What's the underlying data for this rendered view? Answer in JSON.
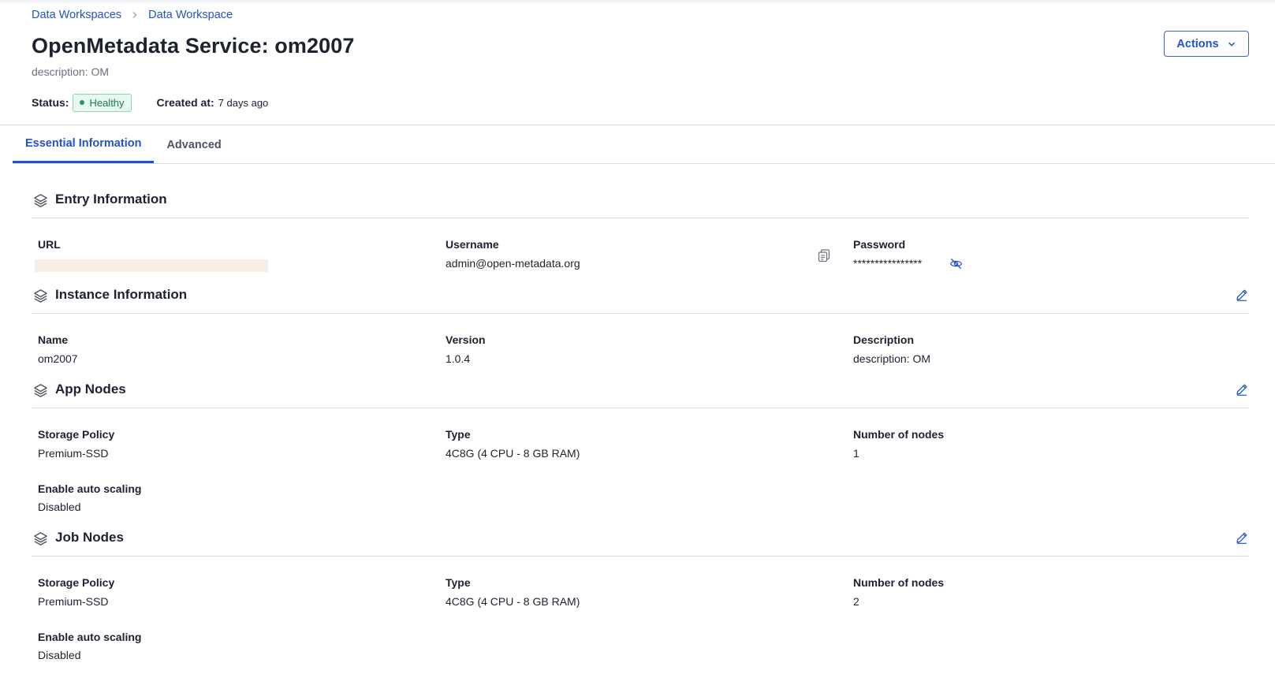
{
  "breadcrumb": [
    "Data Workspaces",
    "Data Workspace"
  ],
  "header": {
    "title": "OpenMetadata Service: om2007",
    "description": "description: OM",
    "status_label": "Status:",
    "status_value": "Healthy",
    "created_label": "Created at:",
    "created_value": "7 days ago",
    "actions_label": "Actions"
  },
  "tabs": [
    {
      "label": "Essential Information",
      "active": true
    },
    {
      "label": "Advanced",
      "active": false
    }
  ],
  "entry": {
    "title": "Entry Information",
    "url_label": "URL",
    "username_label": "Username",
    "username_value": "admin@open-metadata.org",
    "password_label": "Password",
    "password_value": "****************"
  },
  "instance": {
    "title": "Instance Information",
    "name_label": "Name",
    "name_value": "om2007",
    "version_label": "Version",
    "version_value": "1.0.4",
    "description_label": "Description",
    "description_value": "description: OM"
  },
  "app_nodes": {
    "title": "App Nodes",
    "storage_label": "Storage Policy",
    "storage_value": "Premium-SSD",
    "type_label": "Type",
    "type_value": "4C8G (4 CPU - 8 GB RAM)",
    "nodes_label": "Number of nodes",
    "nodes_value": "1",
    "autoscale_label": "Enable auto scaling",
    "autoscale_value": "Disabled"
  },
  "job_nodes": {
    "title": "Job Nodes",
    "storage_label": "Storage Policy",
    "storage_value": "Premium-SSD",
    "type_label": "Type",
    "type_value": "4C8G (4 CPU - 8 GB RAM)",
    "nodes_label": "Number of nodes",
    "nodes_value": "2",
    "autoscale_label": "Enable auto scaling",
    "autoscale_value": "Disabled"
  },
  "icons": {
    "section": "layers-icon",
    "edit": "pencil-icon",
    "copy": "copy-icon",
    "password_toggle": "eye-off-icon",
    "breadcrumb_separator": "chevron-right-icon",
    "actions_caret": "chevron-down-icon"
  },
  "colors": {
    "accent": "#2453c4",
    "healthy_bg": "#e7f8ee",
    "healthy_text": "#1d7a4a"
  }
}
